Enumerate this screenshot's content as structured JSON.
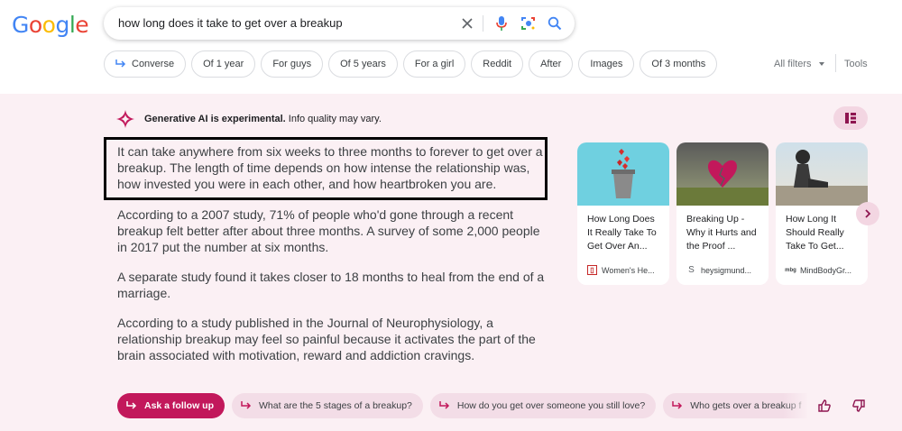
{
  "logo": {
    "letters": [
      "G",
      "o",
      "o",
      "g",
      "l",
      "e"
    ],
    "colors": [
      "#4285f4",
      "#ea4335",
      "#fbbc05",
      "#4285f4",
      "#34a853",
      "#ea4335"
    ]
  },
  "search": {
    "query": "how long does it take to get over a breakup"
  },
  "chips": [
    "Converse",
    "Of 1 year",
    "For guys",
    "Of 5 years",
    "For a girl",
    "Reddit",
    "After",
    "Images",
    "Of 3 months"
  ],
  "toolbar": {
    "all_filters": "All filters",
    "tools": "Tools"
  },
  "ai_overview": {
    "header_bold": "Generative AI is experimental.",
    "header_rest": " Info quality may vary.",
    "paragraphs": [
      "It can take anywhere from six weeks to three months to forever to get over a breakup. The length of time depends on how intense the relationship was, how invested you were in each other, and how heartbroken you are.",
      "According to a 2007 study, 71% of people who'd gone through a recent breakup felt better after about three months. A survey of some 2,000 people in 2017 put the number at six months.",
      "A separate study found it takes closer to 18 months to heal from the end of a marriage.",
      "According to a study published in the Journal of Neurophysiology, a relationship breakup may feel so painful because it activates the part of the brain associated with motivation, reward and addiction cravings."
    ],
    "cards": [
      {
        "title": "How Long Does It Really Take To Get Over An...",
        "source": "Women's He..."
      },
      {
        "title": "Breaking Up - Why it Hurts and the Proof ...",
        "source": "heysigmund..."
      },
      {
        "title": "How Long It Should Really Take To Get...",
        "source": "MindBodyGr..."
      }
    ],
    "followups": [
      "Ask a follow up",
      "What are the 5 stages of a breakup?",
      "How do you get over someone you still love?",
      "Who gets over a breakup f"
    ]
  },
  "colors": {
    "accent": "#c2185b",
    "panel_bg": "#fbf0f4"
  }
}
